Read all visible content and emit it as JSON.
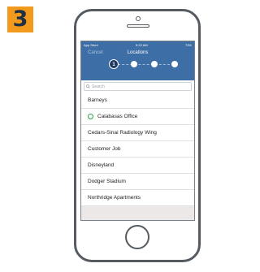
{
  "step_badge": "3",
  "status_bar": {
    "left": "App Store",
    "time": "9:22 AM",
    "right": "73%"
  },
  "nav": {
    "cancel_label": "Cancel",
    "title": "Locations"
  },
  "stepper": {
    "steps": [
      "1",
      "2",
      "3",
      "4"
    ],
    "active_index": 0
  },
  "search": {
    "placeholder": "Search"
  },
  "locations": [
    {
      "name": "Barneys",
      "marked": false
    },
    {
      "name": "Calabasas Office",
      "marked": true
    },
    {
      "name": "Cedars-Sinai Radiology Wing",
      "marked": false
    },
    {
      "name": "Customer Job",
      "marked": false
    },
    {
      "name": "Disneyland",
      "marked": false
    },
    {
      "name": "Dodger Stadium",
      "marked": false
    },
    {
      "name": "Northridge Apartments",
      "marked": false
    }
  ],
  "colors": {
    "badge": "#f19a1c",
    "header": "#3d6ea6",
    "marker": "#2ea44f"
  }
}
